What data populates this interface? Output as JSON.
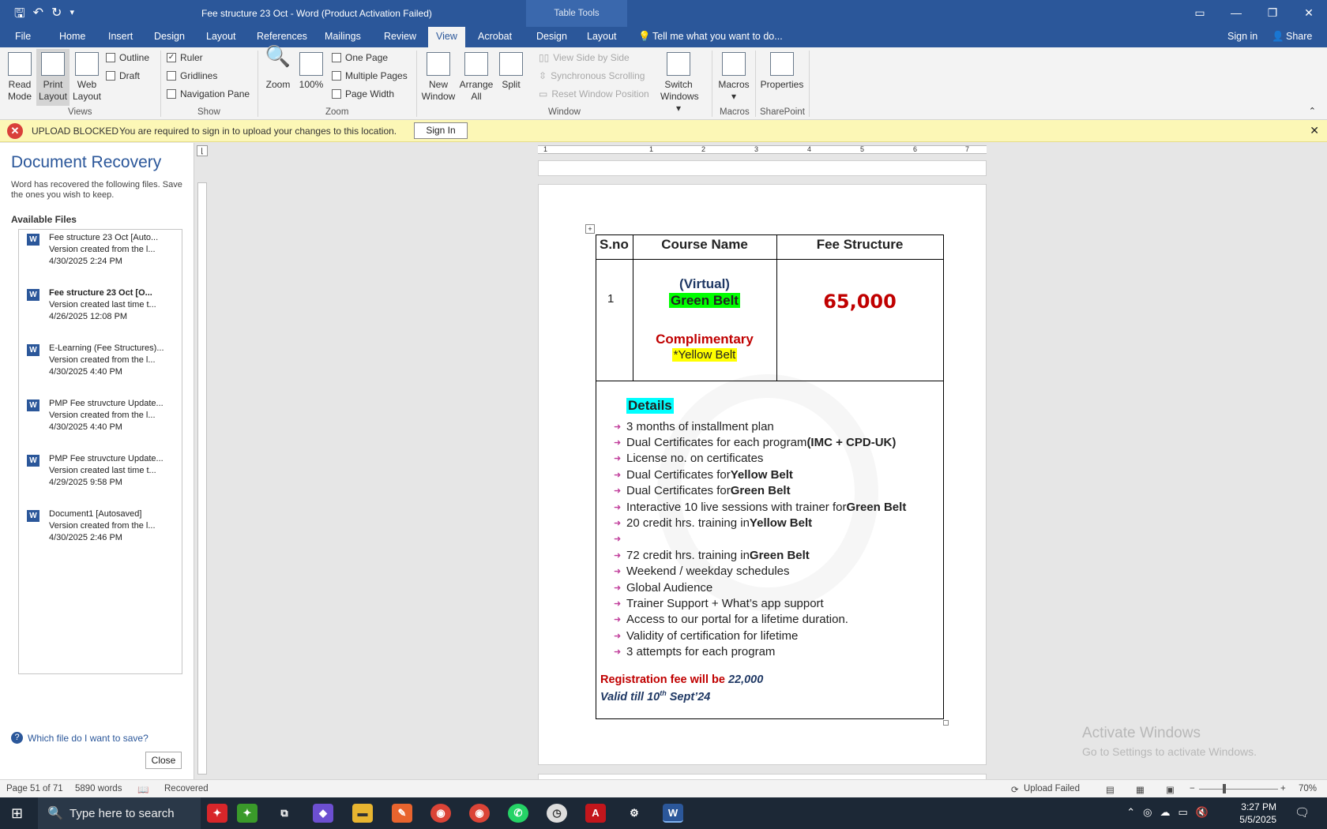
{
  "titlebar": {
    "title": "Fee structure 23 Oct - Word (Product Activation Failed)",
    "table_tools": "Table Tools"
  },
  "menu": {
    "file": "File",
    "home": "Home",
    "insert": "Insert",
    "design": "Design",
    "layout": "Layout",
    "references": "References",
    "mailings": "Mailings",
    "review": "Review",
    "view": "View",
    "acrobat": "Acrobat",
    "tt_design": "Design",
    "tt_layout": "Layout",
    "tell_me": "Tell me what you want to do...",
    "sign_in": "Sign in",
    "share": "Share"
  },
  "ribbon": {
    "read_mode": [
      "Read",
      "Mode"
    ],
    "print_layout": [
      "Print",
      "Layout"
    ],
    "web_layout": [
      "Web",
      "Layout"
    ],
    "outline": "Outline",
    "draft": "Draft",
    "views": "Views",
    "ruler": "Ruler",
    "gridlines": "Gridlines",
    "navigation_pane": "Navigation Pane",
    "show": "Show",
    "zoom_btn": "Zoom",
    "zoom100": "100%",
    "one_page": "One Page",
    "multiple_pages": "Multiple Pages",
    "page_width": "Page Width",
    "zoom_grp": "Zoom",
    "new_window": [
      "New",
      "Window"
    ],
    "arrange_all": [
      "Arrange",
      "All"
    ],
    "split": "Split",
    "view_side": "View Side by Side",
    "sync_scroll": "Synchronous Scrolling",
    "reset_window": "Reset Window Position",
    "switch_windows": [
      "Switch",
      "Windows"
    ],
    "window_grp": "Window",
    "macros": "Macros",
    "macros_grp": "Macros",
    "properties": "Properties",
    "sharepoint": "SharePoint"
  },
  "message": {
    "label": "UPLOAD BLOCKED",
    "text": "You are required to sign in to upload your changes to this location.",
    "button": "Sign In"
  },
  "recovery": {
    "title": "Document Recovery",
    "subtitle": "Word has recovered the following files. Save the ones you wish to keep.",
    "available": "Available Files",
    "files": [
      {
        "name": "Fee structure 23 Oct  [Auto...",
        "desc": "Version created from the l...",
        "date": "4/30/2025 2:24 PM",
        "bold": false
      },
      {
        "name": "Fee structure 23 Oct  [O...",
        "desc": "Version created last time t...",
        "date": "4/26/2025 12:08 PM",
        "bold": true
      },
      {
        "name": "E-Learning (Fee Structures)...",
        "desc": "Version created from the l...",
        "date": "4/30/2025 4:40 PM",
        "bold": false
      },
      {
        "name": "PMP Fee struvcture Update...",
        "desc": "Version created from the l...",
        "date": "4/30/2025 4:40 PM",
        "bold": false
      },
      {
        "name": "PMP Fee struvcture Update...",
        "desc": "Version created last time t...",
        "date": "4/29/2025 9:58 PM",
        "bold": false
      },
      {
        "name": "Document1  [Autosaved]",
        "desc": "Version created from the l...",
        "date": "4/30/2025 2:46 PM",
        "bold": false
      }
    ],
    "help": "Which file do I want to save?",
    "close": "Close"
  },
  "document": {
    "headers": [
      "S.no",
      "Course Name",
      "Fee Structure"
    ],
    "sno": "1",
    "virtual": "(Virtual)",
    "green_belt": "Green Belt",
    "complimentary": "Complimentary",
    "yellow_belt": "*Yellow Belt",
    "fee": "65,000",
    "details": "Details",
    "bullets": [
      {
        "text": "3 months of installment plan",
        "bold": ""
      },
      {
        "text": "Dual Certificates for each program ",
        "bold": "(IMC + CPD-UK)"
      },
      {
        "text": "License no. on certificates",
        "bold": ""
      },
      {
        "text": "Dual Certificates for ",
        "bold": "Yellow Belt"
      },
      {
        "text": "Dual Certificates for ",
        "bold": "Green Belt"
      },
      {
        "text": "Interactive 10 live sessions with trainer for ",
        "bold": "Green Belt"
      },
      {
        "text": "20 credit hrs. training in ",
        "bold": "Yellow Belt"
      },
      {
        "text": "",
        "bold": ""
      },
      {
        "text": "72 credit hrs. training in ",
        "bold": "Green Belt"
      },
      {
        "text": "Weekend / weekday schedules",
        "bold": ""
      },
      {
        "text": "Global Audience",
        "bold": ""
      },
      {
        "text": "Trainer Support + What’s app support",
        "bold": ""
      },
      {
        "text": "Access to our portal for a lifetime duration.",
        "bold": ""
      },
      {
        "text": "Validity of certification for lifetime",
        "bold": ""
      },
      {
        "text": "3 attempts for each program",
        "bold": ""
      }
    ],
    "reg_label": "Registration fee will be ",
    "reg_amount": "22,000",
    "valid_pre": "Valid till 10",
    "valid_sup": "th",
    "valid_post": " Sept’24"
  },
  "activate": {
    "line1": "Activate Windows",
    "line2": "Go to Settings to activate Windows."
  },
  "status": {
    "page": "Page 51 of 71",
    "words": "5890 words",
    "recovered": "Recovered",
    "upload": "Upload Failed",
    "zoom": "70%"
  },
  "taskbar": {
    "search": "Type here to search",
    "time": "3:27 PM",
    "date": "5/5/2025"
  },
  "colors": {
    "accent": "#2b579a",
    "green_highlight": "#00ff00",
    "yellow_highlight": "#ffff00",
    "cyan_highlight": "#00ffff",
    "fee_red": "#c00000",
    "navy": "#1f3864"
  }
}
